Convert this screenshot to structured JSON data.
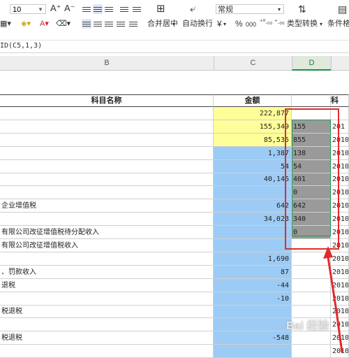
{
  "toolbar": {
    "font_size": "10",
    "font_grow": "A⁺",
    "font_shrink": "A⁻",
    "merge_label": "合并居中",
    "wrap_label": "自动换行",
    "number_format": "常规",
    "currency": "¥",
    "percent": "%",
    "thousands": "000",
    "dec_inc": "⁺⁰.₀₀",
    "dec_dec": "⁺.₀₀",
    "convert_label": "类型转换",
    "cond_label": "条件格式"
  },
  "formula": "ID(C5,1,3)",
  "columns": {
    "b": "B",
    "c": "C",
    "d": "D"
  },
  "header": {
    "name": "科目名称",
    "amount": "金额",
    "e": "科"
  },
  "rows": [
    {
      "b": "",
      "c": "222,877",
      "d": "",
      "e": "",
      "fill": "yellow"
    },
    {
      "b": "",
      "c": "155,349",
      "d": "155",
      "e": "201",
      "fill": "yellow"
    },
    {
      "b": "",
      "c": "85,535",
      "d": "855",
      "e": "2010",
      "fill": "yellow"
    },
    {
      "b": "",
      "c": "1,387",
      "d": "138",
      "e": "2010",
      "fill": "blue"
    },
    {
      "b": "",
      "c": "54",
      "d": "54",
      "e": "2010",
      "fill": "blue"
    },
    {
      "b": "",
      "c": "40,146",
      "d": "401",
      "e": "2010",
      "fill": "blue"
    },
    {
      "b": "",
      "c": "",
      "d": "0",
      "e": "2010",
      "fill": "blue"
    },
    {
      "b": "企业增值税",
      "c": "642",
      "d": "642",
      "e": "2010",
      "fill": "blue"
    },
    {
      "b": "",
      "c": "34,023",
      "d": "340",
      "e": "2010",
      "fill": "blue"
    },
    {
      "b": "有限公司改征增值税待分配收入",
      "c": "",
      "d": "0",
      "e": "2010",
      "fill": "blue"
    },
    {
      "b": "有限公司改征增值税收入",
      "c": "",
      "d": "",
      "e": "2010",
      "fill": "blue"
    },
    {
      "b": "",
      "c": "1,690",
      "d": "",
      "e": "2010",
      "fill": "blue"
    },
    {
      "b": "、罚款收入",
      "c": "87",
      "d": "",
      "e": "2010",
      "fill": "blue"
    },
    {
      "b": "退税",
      "c": "-44",
      "d": "",
      "e": "2010",
      "fill": "blue"
    },
    {
      "b": "",
      "c": "-10",
      "d": "",
      "e": "2010",
      "fill": "blue"
    },
    {
      "b": "税退税",
      "c": "",
      "d": "",
      "e": "2010",
      "fill": "blue"
    },
    {
      "b": "",
      "c": "",
      "d": "",
      "e": "2010",
      "fill": "blue"
    },
    {
      "b": "税退税",
      "c": "-548",
      "d": "",
      "e": "2010",
      "fill": "blue"
    },
    {
      "b": "",
      "c": "",
      "d": "",
      "e": "2010",
      "fill": "blue"
    }
  ],
  "colors": {
    "red_box": "#e12b2b",
    "green_select": "#1e9a50",
    "arrow": "#e12b2b"
  },
  "watermark": "Bai 经验"
}
